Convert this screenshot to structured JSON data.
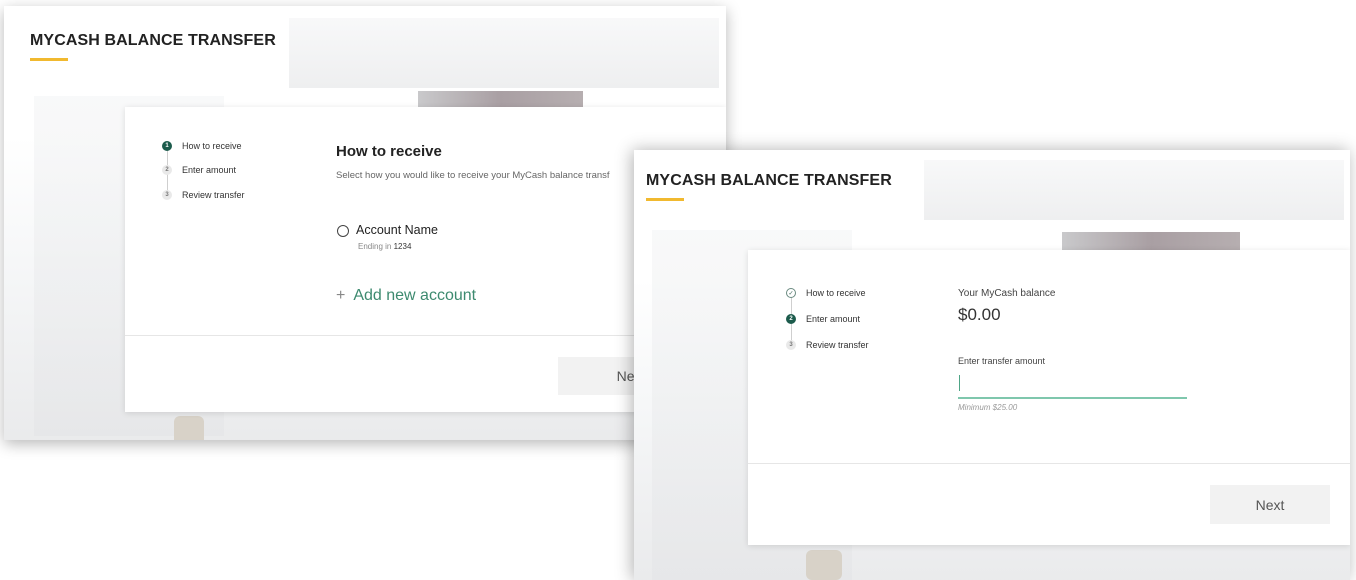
{
  "screen1": {
    "app_title": "MYCASH BALANCE TRANSFER",
    "steps": [
      {
        "number": "1",
        "label": "How to receive",
        "state": "active"
      },
      {
        "number": "2",
        "label": "Enter amount",
        "state": "idle"
      },
      {
        "number": "3",
        "label": "Review transfer",
        "state": "idle"
      }
    ],
    "heading": "How to receive",
    "subtext": "Select how you would like to receive your MyCash balance transf",
    "account": {
      "name": "Account Name",
      "ending_label": "Ending in",
      "ending_digits": "1234"
    },
    "add_account_label": "Add new account",
    "next_label": "Next"
  },
  "screen2": {
    "app_title": "MYCASH BALANCE TRANSFER",
    "steps": [
      {
        "number": "✓",
        "label": "How to receive",
        "state": "done"
      },
      {
        "number": "2",
        "label": "Enter amount",
        "state": "active"
      },
      {
        "number": "3",
        "label": "Review transfer",
        "state": "idle"
      }
    ],
    "balance_label": "Your MyCash balance",
    "balance_value": "$0.00",
    "amount_label": "Enter transfer amount",
    "amount_value": "",
    "minimum_hint": "Minimum $25.00",
    "next_label": "Next"
  },
  "colors": {
    "accent_yellow": "#f1b92f",
    "brand_green": "#1c5b4c",
    "input_underline": "#7fc7ad",
    "link_green": "#3d8a6f"
  }
}
